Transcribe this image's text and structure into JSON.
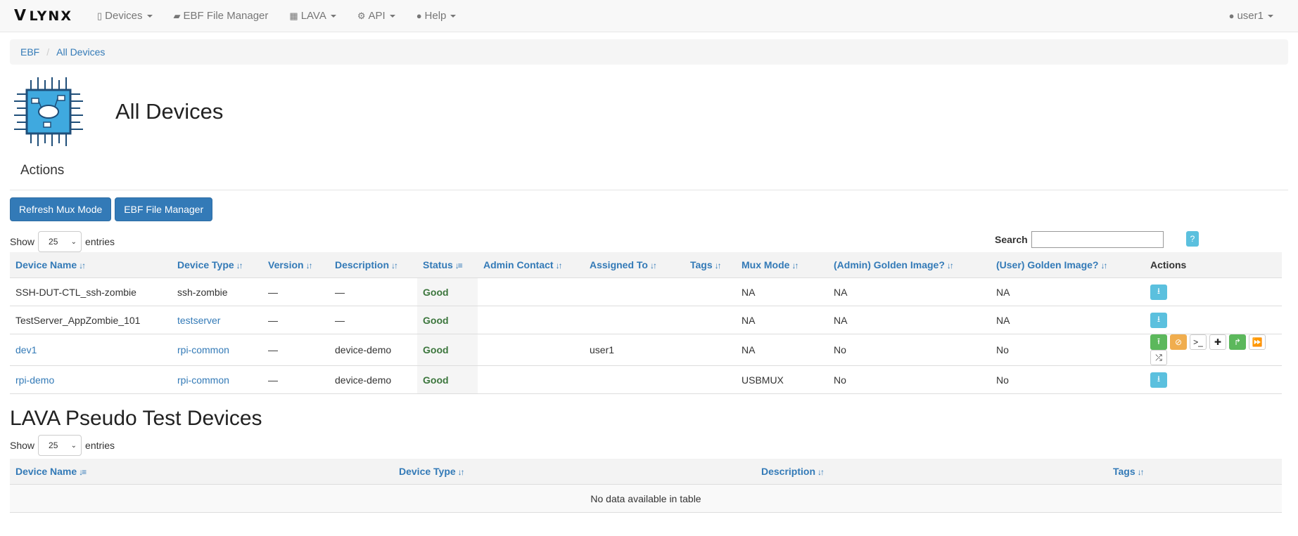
{
  "navbar": {
    "brand": "LYNX",
    "items": [
      {
        "label": "Devices",
        "icon": "devices-icon",
        "dropdown": true
      },
      {
        "label": "EBF File Manager",
        "icon": "folder-open-icon",
        "dropdown": false
      },
      {
        "label": "LAVA",
        "icon": "calendar-icon",
        "dropdown": true
      },
      {
        "label": "API",
        "icon": "gear-icon",
        "dropdown": true
      },
      {
        "label": "Help",
        "icon": "question-circle-icon",
        "dropdown": true
      }
    ],
    "user": "user1"
  },
  "breadcrumb": [
    "EBF",
    "All Devices"
  ],
  "page_title": "All Devices",
  "actions_title": "Actions",
  "buttons": {
    "refresh": "Refresh Mux Mode",
    "ebf": "EBF File Manager"
  },
  "devices_table": {
    "show_label": "Show",
    "entries_label": "entries",
    "page_size": "25",
    "search_label": "Search",
    "help": "?",
    "columns": [
      "Device Name",
      "Device Type",
      "Version",
      "Description",
      "Status",
      "Admin Contact",
      "Assigned To",
      "Tags",
      "Mux Mode",
      "(Admin) Golden Image?",
      "(User) Golden Image?",
      "Actions"
    ],
    "rows": [
      {
        "name": "SSH-DUT-CTL_ssh-zombie",
        "type": "ssh-zombie",
        "version": "—",
        "description": "—",
        "status": "Good",
        "admin": "",
        "assigned": "",
        "tags": "",
        "mux": "NA",
        "admin_golden": "NA",
        "user_golden": "NA"
      },
      {
        "name": "TestServer_AppZombie_101",
        "type": "testserver",
        "version": "—",
        "description": "—",
        "status": "Good",
        "admin": "",
        "assigned": "",
        "tags": "",
        "mux": "NA",
        "admin_golden": "NA",
        "user_golden": "NA"
      },
      {
        "name": "dev1",
        "type": "rpi-common",
        "version": "—",
        "description": "device-demo",
        "status": "Good",
        "admin": "",
        "assigned": "user1",
        "tags": "",
        "mux": "NA",
        "admin_golden": "No",
        "user_golden": "No"
      },
      {
        "name": "rpi-demo",
        "type": "rpi-common",
        "version": "—",
        "description": "device-demo",
        "status": "Good",
        "admin": "",
        "assigned": "",
        "tags": "",
        "mux": "USBMUX",
        "admin_golden": "No",
        "user_golden": "No"
      }
    ]
  },
  "lava_section": {
    "title": "LAVA Pseudo Test Devices",
    "show_label": "Show",
    "entries_label": "entries",
    "page_size": "25",
    "columns": [
      "Device Name",
      "Device Type",
      "Description",
      "Tags"
    ],
    "empty_message": "No data available in table"
  },
  "colors": {
    "link": "#337ab7",
    "good": "#3c763d",
    "info": "#5bc0de",
    "success": "#5cb85c",
    "warning": "#f0ad4e"
  }
}
